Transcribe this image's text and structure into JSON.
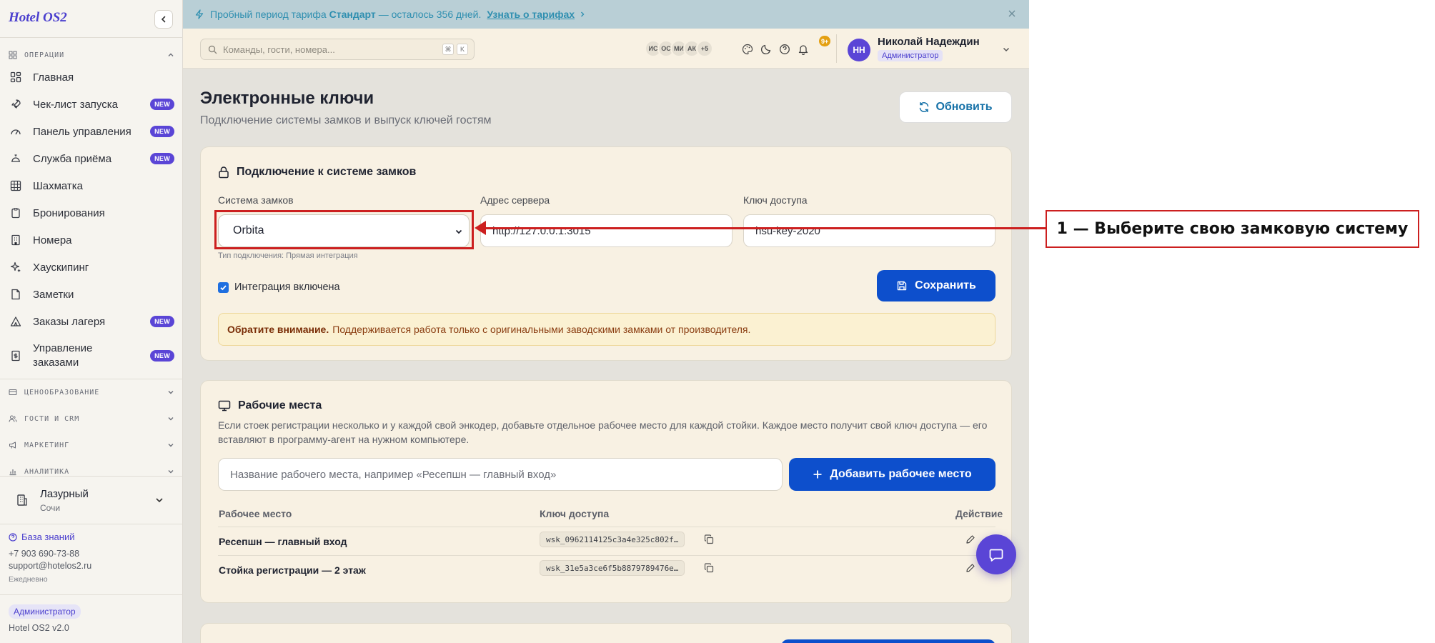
{
  "brand": "Hotel OS2",
  "banner": {
    "text_prefix": "Пробный период тарифа",
    "plan": "Стандарт",
    "text_suffix": "— осталось 356 дней.",
    "link": "Узнать о тарифах"
  },
  "sidebar": {
    "section_operations": "ОПЕРАЦИИ",
    "items": [
      {
        "label": "Главная",
        "icon": "grid-icon",
        "badge": ""
      },
      {
        "label": "Чек-лист запуска",
        "icon": "rocket-icon",
        "badge": "NEW"
      },
      {
        "label": "Панель управления",
        "icon": "gauge-icon",
        "badge": "NEW"
      },
      {
        "label": "Служба приёма",
        "icon": "bell-service-icon",
        "badge": "NEW"
      },
      {
        "label": "Шахматка",
        "icon": "table-grid-icon",
        "badge": ""
      },
      {
        "label": "Бронирования",
        "icon": "clipboard-icon",
        "badge": ""
      },
      {
        "label": "Номера",
        "icon": "building-icon",
        "badge": ""
      },
      {
        "label": "Хаускипинг",
        "icon": "sparkle-icon",
        "badge": ""
      },
      {
        "label": "Заметки",
        "icon": "note-icon",
        "badge": ""
      },
      {
        "label": "Заказы лагеря",
        "icon": "tent-icon",
        "badge": "NEW"
      },
      {
        "label": "Управление заказами",
        "label_line1": "Управление",
        "label_line2": "заказами",
        "icon": "receipt-icon",
        "badge": "NEW"
      }
    ],
    "sections": [
      "ЦЕНООБРАЗОВАНИЕ",
      "ГОСТИ И CRM",
      "МАРКЕТИНГ",
      "АНАЛИТИКА"
    ],
    "hotel": {
      "name": "Лазурный",
      "city": "Сочи"
    },
    "knowledge_base": "База знаний",
    "phone": "+7 903 690-73-88",
    "email": "support@hotelos2.ru",
    "schedule": "Ежедневно",
    "role": "Администратор",
    "version": "Hotel OS2 v2.0"
  },
  "topbar": {
    "search_placeholder": "Команды, гости, номера...",
    "kbd1": "⌘",
    "kbd2": "K",
    "avatars": [
      "ИС",
      "ОС",
      "МИ",
      "АК",
      "+5"
    ],
    "notifications": "9+",
    "user": {
      "initials": "НН",
      "name": "Николай Надеждин",
      "role": "Администратор"
    }
  },
  "page": {
    "title": "Электронные ключи",
    "subtitle": "Подключение системы замков и выпуск ключей гостям",
    "refresh": "Обновить"
  },
  "connection": {
    "title": "Подключение к системе замков",
    "lock_system_label": "Система замков",
    "lock_system_value": "Orbita",
    "connection_type_hint": "Тип подключения: Прямая интеграция",
    "server_label": "Адрес сервера",
    "server_value": "http://127.0.0.1:3015",
    "key_label": "Ключ доступа",
    "key_value": "hsu-key-2020",
    "integration_label": "Интеграция включена",
    "integration_enabled": true,
    "save": "Сохранить",
    "alert_bold": "Обратите внимание.",
    "alert_text": "Поддерживается работа только с оригинальными заводскими замками от производителя."
  },
  "workstations": {
    "title": "Рабочие места",
    "description": "Если стоек регистрации несколько и у каждой свой энкодер, добавьте отдельное рабочее место для каждой стойки. Каждое место получит свой ключ доступа — его вставляют в программу-агент на нужном компьютере.",
    "input_placeholder": "Название рабочего места, например «Ресепшн — главный вход»",
    "add_button": "Добавить рабочее место",
    "columns": [
      "Рабочее место",
      "Ключ доступа",
      "Действие"
    ],
    "rows": [
      {
        "name": "Ресепшн — главный вход",
        "key": "wsk_0962114125c3a4e325c802f…"
      },
      {
        "name": "Стойка регистрации — 2 этаж",
        "key": "wsk_31e5a3ce6f5b8879789476e…"
      }
    ]
  },
  "annotation": {
    "text": "1 — Выберите свою замковую систему",
    "color": "#cc1f1f"
  },
  "colors": {
    "accent": "#5a45d6",
    "primary_button": "#0d4fcc",
    "banner_bg": "#b9cfd6",
    "card_bg": "#f8f1e3"
  }
}
